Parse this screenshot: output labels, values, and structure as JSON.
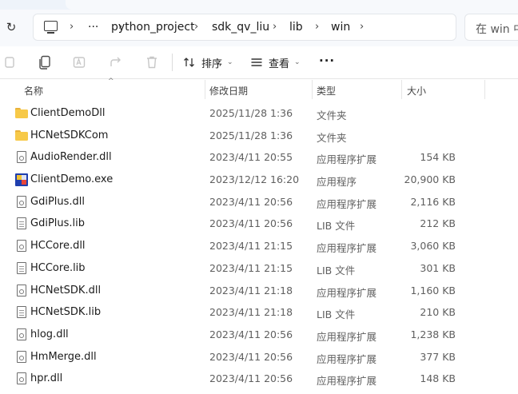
{
  "address": {
    "segments": [
      "python_project",
      "sdk_qv_liu",
      "lib",
      "win"
    ],
    "ellipsis": "···",
    "search_placeholder": "在 win 中"
  },
  "toolbar": {
    "sort_label": "排序",
    "view_label": "查看",
    "more_label": "···"
  },
  "columns": {
    "name": "名称",
    "modified": "修改日期",
    "type": "类型",
    "size": "大小"
  },
  "files": [
    {
      "name": "ClientDemoDll",
      "modified": "2025/11/28 1:36",
      "type": "文件夹",
      "size": "",
      "icon": "folder-icon"
    },
    {
      "name": "HCNetSDKCom",
      "modified": "2025/11/28 1:36",
      "type": "文件夹",
      "size": "",
      "icon": "folder-icon"
    },
    {
      "name": "AudioRender.dll",
      "modified": "2023/4/11 20:55",
      "type": "应用程序扩展",
      "size": "154 KB",
      "icon": "dll-file-icon"
    },
    {
      "name": "ClientDemo.exe",
      "modified": "2023/12/12 16:20",
      "type": "应用程序",
      "size": "20,900 KB",
      "icon": "exe-app-icon"
    },
    {
      "name": "GdiPlus.dll",
      "modified": "2023/4/11 20:56",
      "type": "应用程序扩展",
      "size": "2,116 KB",
      "icon": "dll-file-icon"
    },
    {
      "name": "GdiPlus.lib",
      "modified": "2023/4/11 20:56",
      "type": "LIB 文件",
      "size": "212 KB",
      "icon": "lib-file-icon"
    },
    {
      "name": "HCCore.dll",
      "modified": "2023/4/11 21:15",
      "type": "应用程序扩展",
      "size": "3,060 KB",
      "icon": "dll-file-icon"
    },
    {
      "name": "HCCore.lib",
      "modified": "2023/4/11 21:15",
      "type": "LIB 文件",
      "size": "301 KB",
      "icon": "lib-file-icon"
    },
    {
      "name": "HCNetSDK.dll",
      "modified": "2023/4/11 21:18",
      "type": "应用程序扩展",
      "size": "1,160 KB",
      "icon": "dll-file-icon"
    },
    {
      "name": "HCNetSDK.lib",
      "modified": "2023/4/11 21:18",
      "type": "LIB 文件",
      "size": "210 KB",
      "icon": "lib-file-icon"
    },
    {
      "name": "hlog.dll",
      "modified": "2023/4/11 20:56",
      "type": "应用程序扩展",
      "size": "1,238 KB",
      "icon": "dll-file-icon"
    },
    {
      "name": "HmMerge.dll",
      "modified": "2023/4/11 20:56",
      "type": "应用程序扩展",
      "size": "377 KB",
      "icon": "dll-file-icon"
    },
    {
      "name": "hpr.dll",
      "modified": "2023/4/11 20:56",
      "type": "应用程序扩展",
      "size": "148 KB",
      "icon": "dll-file-icon"
    }
  ]
}
